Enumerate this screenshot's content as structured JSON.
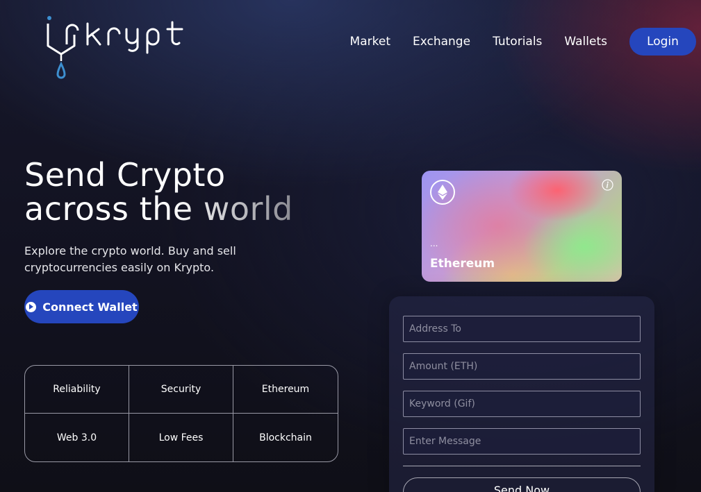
{
  "header": {
    "logo_text": "krypt",
    "nav": [
      "Market",
      "Exchange",
      "Tutorials",
      "Wallets"
    ],
    "login_label": "Login"
  },
  "hero": {
    "title_line1": "Send Crypto",
    "title_line2": "across the world",
    "subtitle": "Explore the crypto world. Buy and sell cryptocurrencies easily on Krypto.",
    "connect_label": "Connect Wallet"
  },
  "features": [
    "Reliability",
    "Security",
    "Ethereum",
    "Web 3.0",
    "Low Fees",
    "Blockchain"
  ],
  "card": {
    "address": "...",
    "name": "Ethereum"
  },
  "form": {
    "address_placeholder": "Address To",
    "amount_placeholder": "Amount (ETH)",
    "keyword_placeholder": "Keyword (Gif)",
    "message_placeholder": "Enter Message",
    "send_label": "Send Now"
  },
  "colors": {
    "accent": "#2546bd",
    "logo_drop": "#3d8fd0"
  },
  "icons": {
    "card_logo": "ethereum-icon",
    "card_info": "info-icon",
    "connect": "play-icon"
  }
}
